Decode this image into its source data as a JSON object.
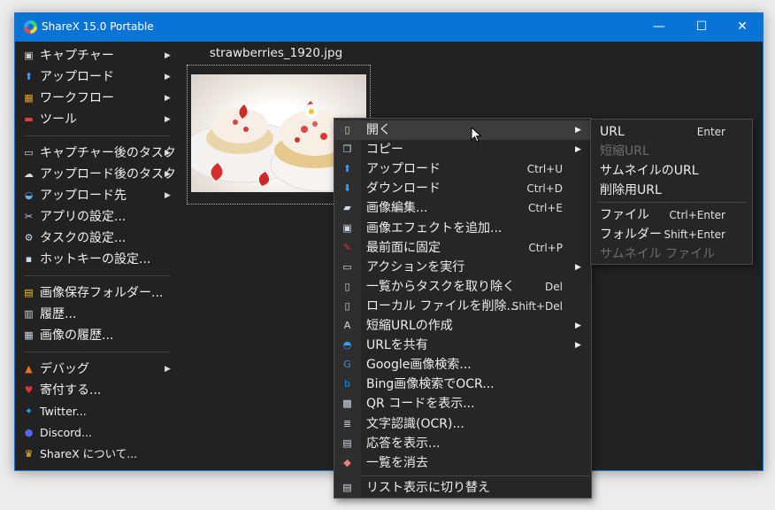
{
  "window": {
    "title": "ShareX 15.0 Portable",
    "minimize": "—",
    "maximize": "☐",
    "close": "✕"
  },
  "sidebar": {
    "groups": [
      [
        {
          "label": "キャプチャー",
          "icon": "capture-icon",
          "arrow": "▶"
        },
        {
          "label": "アップロード",
          "icon": "upload-icon",
          "arrow": "▶"
        },
        {
          "label": "ワークフロー",
          "icon": "workflow-icon",
          "arrow": "▶"
        },
        {
          "label": "ツール",
          "icon": "tools-icon",
          "arrow": "▶"
        }
      ],
      [
        {
          "label": "キャプチャー後のタスク",
          "icon": "after-capture-icon",
          "arrow": "▶"
        },
        {
          "label": "アップロード後のタスク",
          "icon": "after-upload-icon",
          "arrow": "▶"
        },
        {
          "label": "アップロード先",
          "icon": "destination-icon",
          "arrow": "▶"
        },
        {
          "label": "アプリの設定...",
          "icon": "app-settings-icon"
        },
        {
          "label": "タスクの設定...",
          "icon": "task-settings-icon"
        },
        {
          "label": "ホットキーの設定...",
          "icon": "hotkey-settings-icon"
        }
      ],
      [
        {
          "label": "画像保存フォルダー...",
          "icon": "folder-icon"
        },
        {
          "label": "履歴...",
          "icon": "history-icon"
        },
        {
          "label": "画像の履歴...",
          "icon": "image-history-icon"
        }
      ],
      [
        {
          "label": "デバッグ",
          "icon": "debug-icon",
          "arrow": "▶"
        },
        {
          "label": "寄付する...",
          "icon": "heart-icon"
        },
        {
          "label": "Twitter...",
          "icon": "twitter-icon"
        },
        {
          "label": "Discord...",
          "icon": "discord-icon"
        },
        {
          "label": "ShareX について...",
          "icon": "crown-icon"
        }
      ]
    ]
  },
  "thumbnail": {
    "filename": "strawberries_1920.jpg"
  },
  "context_menu": {
    "items": [
      {
        "label": "開く",
        "icon": "open-icon",
        "arrow": "▶",
        "hover": true
      },
      {
        "label": "コピー",
        "icon": "copy-icon",
        "arrow": "▶"
      },
      {
        "label": "アップロード",
        "icon": "upload-icon",
        "shortcut": "Ctrl+U"
      },
      {
        "label": "ダウンロード",
        "icon": "download-icon",
        "shortcut": "Ctrl+D"
      },
      {
        "label": "画像編集...",
        "icon": "edit-image-icon",
        "shortcut": "Ctrl+E"
      },
      {
        "label": "画像エフェクトを追加...",
        "icon": "effects-icon"
      },
      {
        "label": "最前面に固定",
        "icon": "pin-icon",
        "shortcut": "Ctrl+P"
      },
      {
        "label": "アクションを実行",
        "icon": "action-icon",
        "arrow": "▶"
      },
      {
        "label": "一覧からタスクを取り除く",
        "icon": "remove-task-icon",
        "shortcut": "Del"
      },
      {
        "label": "ローカル ファイルを削除...",
        "icon": "delete-file-icon",
        "shortcut": "Shift+Del"
      },
      {
        "label": "短縮URLの作成",
        "icon": "shorten-url-icon",
        "arrow": "▶"
      },
      {
        "label": "URLを共有",
        "icon": "share-url-icon",
        "arrow": "▶"
      },
      {
        "label": "Google画像検索...",
        "icon": "google-icon"
      },
      {
        "label": "Bing画像検索でOCR...",
        "icon": "bing-icon"
      },
      {
        "label": "QR コードを表示...",
        "icon": "qr-icon"
      },
      {
        "label": "文字認識(OCR)...",
        "icon": "ocr-icon"
      },
      {
        "label": "応答を表示...",
        "icon": "response-icon"
      },
      {
        "label": "一覧を消去",
        "icon": "eraser-icon"
      }
    ],
    "footer": {
      "label": "リスト表示に切り替え",
      "icon": "list-view-icon"
    }
  },
  "submenu": {
    "groups": [
      [
        {
          "label": "URL",
          "shortcut": "Enter"
        },
        {
          "label": "短縮URL",
          "disabled": true
        },
        {
          "label": "サムネイルのURL"
        },
        {
          "label": "削除用URL"
        }
      ],
      [
        {
          "label": "ファイル",
          "shortcut": "Ctrl+Enter"
        },
        {
          "label": "フォルダー",
          "shortcut": "Shift+Enter"
        },
        {
          "label": "サムネイル ファイル",
          "disabled": true
        }
      ]
    ]
  }
}
